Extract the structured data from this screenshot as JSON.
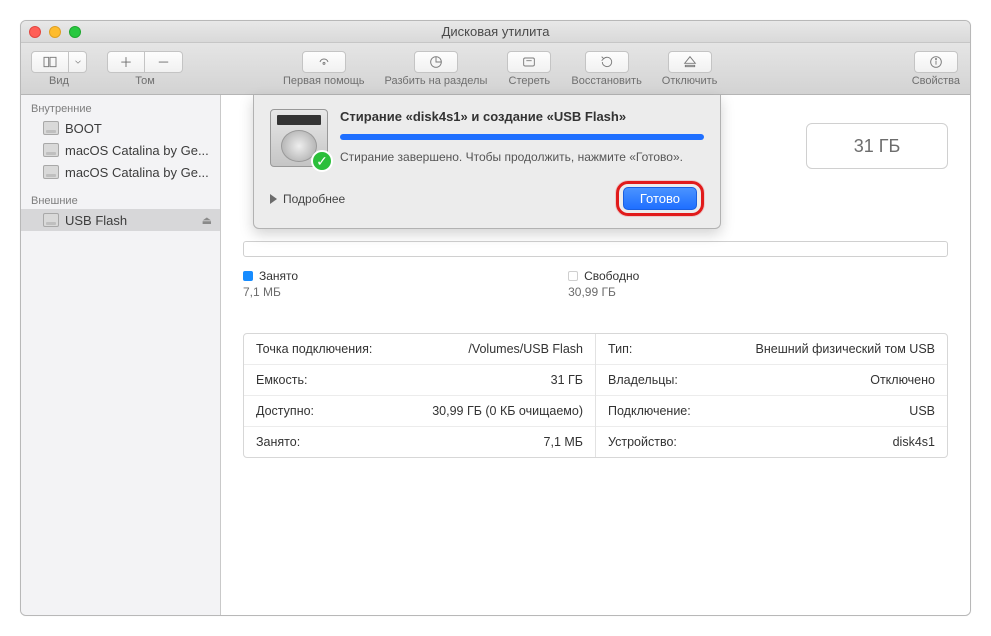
{
  "window_title": "Дисковая утилита",
  "toolbar": {
    "view": "Вид",
    "volume": "Том",
    "first_aid": "Первая помощь",
    "partition": "Разбить на разделы",
    "erase": "Стереть",
    "restore": "Восстановить",
    "unmount": "Отключить",
    "info": "Свойства"
  },
  "sidebar": {
    "internal_header": "Внутренние",
    "external_header": "Внешние",
    "internal": [
      {
        "label": "BOOT"
      },
      {
        "label": "macOS Catalina by Ge..."
      },
      {
        "label": "macOS Catalina by Ge..."
      }
    ],
    "external": [
      {
        "label": "USB Flash"
      }
    ]
  },
  "main": {
    "size_chip": "31 ГБ",
    "legend": {
      "used_label": "Занято",
      "used_value": "7,1 МБ",
      "free_label": "Свободно",
      "free_value": "30,99 ГБ"
    },
    "info_left": [
      {
        "key": "Точка подключения:",
        "val": "/Volumes/USB Flash"
      },
      {
        "key": "Емкость:",
        "val": "31 ГБ"
      },
      {
        "key": "Доступно:",
        "val": "30,99 ГБ (0 КБ очищаемо)"
      },
      {
        "key": "Занято:",
        "val": "7,1 МБ"
      }
    ],
    "info_right": [
      {
        "key": "Тип:",
        "val": "Внешний физический том USB"
      },
      {
        "key": "Владельцы:",
        "val": "Отключено"
      },
      {
        "key": "Подключение:",
        "val": "USB"
      },
      {
        "key": "Устройство:",
        "val": "disk4s1"
      }
    ]
  },
  "sheet": {
    "title": "Стирание «disk4s1» и создание «USB Flash»",
    "message": "Стирание завершено. Чтобы продолжить, нажмите «Готово».",
    "details": "Подробнее",
    "done": "Готово"
  }
}
